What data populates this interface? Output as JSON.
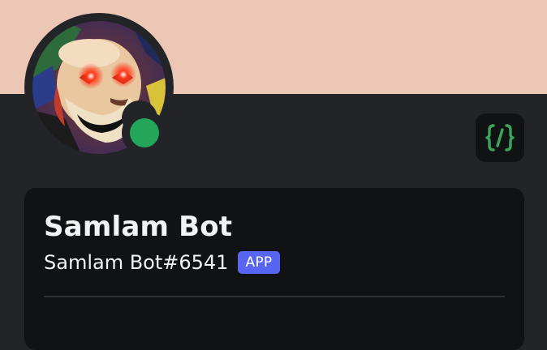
{
  "profile": {
    "display_name": "Samlam Bot",
    "username": "Samlam Bot#6541",
    "bot_tag": "APP",
    "status": "online"
  },
  "badges": [
    {
      "icon": "code-braces-icon",
      "meaning": "active-developer"
    }
  ],
  "colors": {
    "banner": "#ecc7b5",
    "panel": "#232428",
    "card": "#111214",
    "status_online": "#23a55a",
    "app_badge": "#5865f2",
    "badge_icon": "#3ba55c",
    "text": "#f2f3f5"
  }
}
